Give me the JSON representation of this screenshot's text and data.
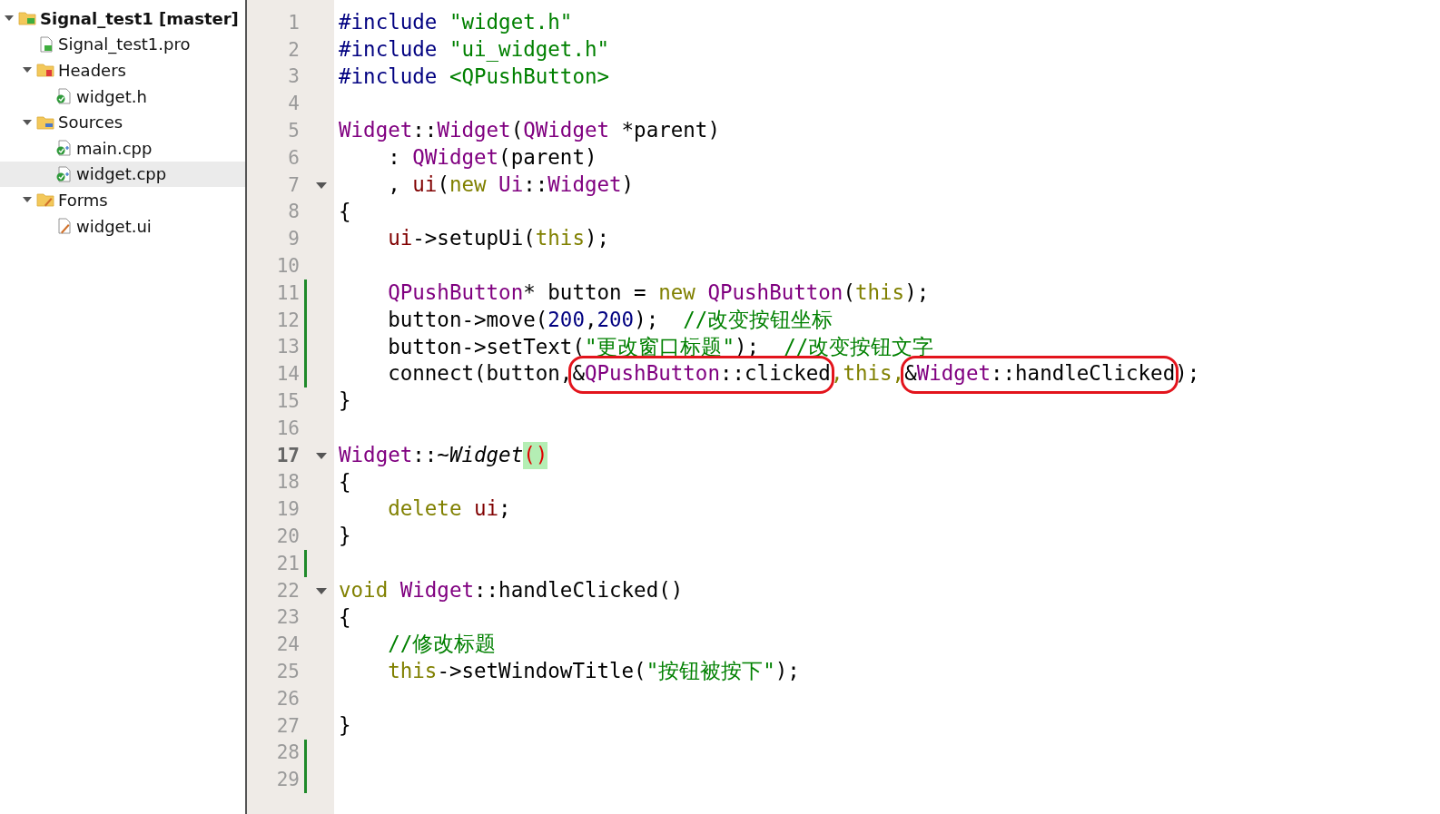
{
  "project_tree": [
    {
      "label": "Signal_test1 [master]",
      "kind": "project",
      "expanded": true,
      "selected": false,
      "children": [
        {
          "label": "Signal_test1.pro",
          "kind": "profile",
          "selected": false
        },
        {
          "label": "Headers",
          "kind": "headers",
          "expanded": true,
          "selected": false,
          "children": [
            {
              "label": "widget.h",
              "kind": "header",
              "selected": false
            }
          ]
        },
        {
          "label": "Sources",
          "kind": "sources",
          "expanded": true,
          "selected": false,
          "children": [
            {
              "label": "main.cpp",
              "kind": "source",
              "selected": false
            },
            {
              "label": "widget.cpp",
              "kind": "source",
              "selected": true
            }
          ]
        },
        {
          "label": "Forms",
          "kind": "forms",
          "expanded": true,
          "selected": false,
          "children": [
            {
              "label": "widget.ui",
              "kind": "form",
              "selected": false
            }
          ]
        }
      ]
    }
  ],
  "editor": {
    "lines": [
      {
        "number": "1",
        "changed": false,
        "fold": false,
        "current": false,
        "tokens": [
          {
            "t": "#include ",
            "kind": "preproc"
          },
          {
            "t": "\"widget.h\"",
            "kind": "string"
          }
        ]
      },
      {
        "number": "2",
        "changed": false,
        "fold": false,
        "current": false,
        "tokens": [
          {
            "t": "#include ",
            "kind": "preproc"
          },
          {
            "t": "\"ui_widget.h\"",
            "kind": "string"
          }
        ]
      },
      {
        "number": "3",
        "changed": false,
        "fold": false,
        "current": false,
        "tokens": [
          {
            "t": "#include ",
            "kind": "preproc"
          },
          {
            "t": "<QPushButton>",
            "kind": "string"
          }
        ]
      },
      {
        "number": "4",
        "changed": false,
        "fold": false,
        "current": false
      },
      {
        "number": "5",
        "changed": false,
        "fold": false,
        "current": false,
        "tokens": [
          {
            "t": "Widget",
            "kind": "type"
          },
          {
            "t": "::",
            "kind": "plain"
          },
          {
            "t": "Widget",
            "kind": "type"
          },
          {
            "t": "(",
            "kind": "plain"
          },
          {
            "t": "QWidget",
            "kind": "type"
          },
          {
            "t": " *parent)",
            "kind": "plain"
          }
        ]
      },
      {
        "number": "6",
        "changed": false,
        "fold": false,
        "current": false,
        "tokens": [
          {
            "t": "    : ",
            "kind": "plain"
          },
          {
            "t": "QWidget",
            "kind": "type"
          },
          {
            "t": "(parent)",
            "kind": "plain"
          }
        ]
      },
      {
        "number": "7",
        "changed": false,
        "fold": true,
        "current": false,
        "tokens": [
          {
            "t": "    , ",
            "kind": "plain"
          },
          {
            "t": "ui",
            "kind": "field"
          },
          {
            "t": "(",
            "kind": "plain"
          },
          {
            "t": "new ",
            "kind": "keyword"
          },
          {
            "t": "Ui",
            "kind": "type"
          },
          {
            "t": "::",
            "kind": "plain"
          },
          {
            "t": "Widget",
            "kind": "type"
          },
          {
            "t": ")",
            "kind": "plain"
          }
        ]
      },
      {
        "number": "8",
        "changed": false,
        "fold": false,
        "current": false,
        "tokens": [
          {
            "t": "{",
            "kind": "plain"
          }
        ]
      },
      {
        "number": "9",
        "changed": false,
        "fold": false,
        "current": false,
        "tokens": [
          {
            "t": "    ui",
            "kind": "field"
          },
          {
            "t": "->setupUi(",
            "kind": "plain"
          },
          {
            "t": "this",
            "kind": "keyword"
          },
          {
            "t": ");",
            "kind": "plain"
          }
        ]
      },
      {
        "number": "10",
        "changed": false,
        "fold": false,
        "current": false
      },
      {
        "number": "11",
        "changed": true,
        "fold": false,
        "current": false,
        "tokens": [
          {
            "t": "    QPushButton",
            "kind": "type"
          },
          {
            "t": "* button = ",
            "kind": "plain"
          },
          {
            "t": "new ",
            "kind": "keyword"
          },
          {
            "t": "QPushButton",
            "kind": "type"
          },
          {
            "t": "(",
            "kind": "plain"
          },
          {
            "t": "this",
            "kind": "keyword"
          },
          {
            "t": ");",
            "kind": "plain"
          }
        ]
      },
      {
        "number": "12",
        "changed": true,
        "fold": false,
        "current": false,
        "tokens": [
          {
            "t": "    button->move(",
            "kind": "plain"
          },
          {
            "t": "200",
            "kind": "number"
          },
          {
            "t": ",",
            "kind": "plain"
          },
          {
            "t": "200",
            "kind": "number"
          },
          {
            "t": ");  ",
            "kind": "plain"
          },
          {
            "t": "//改变按钮坐标",
            "kind": "comment"
          }
        ]
      },
      {
        "number": "13",
        "changed": true,
        "fold": false,
        "current": false,
        "tokens": [
          {
            "t": "    button->setText(",
            "kind": "plain"
          },
          {
            "t": "\"更改窗口标题\"",
            "kind": "string"
          },
          {
            "t": ");  ",
            "kind": "plain"
          },
          {
            "t": "//改变按钮文字",
            "kind": "comment"
          }
        ]
      },
      {
        "number": "14",
        "changed": true,
        "fold": false,
        "current": false,
        "tokens": [
          {
            "t": "    connect(button,",
            "kind": "plain"
          },
          {
            "kind": "circled",
            "tokens": [
              {
                "t": "&",
                "kind": "plain"
              },
              {
                "t": "QPushButton",
                "kind": "type"
              },
              {
                "t": "::clicked",
                "kind": "plain"
              }
            ]
          },
          {
            "t": ",this,",
            "kind": "keyword"
          },
          {
            "kind": "circled",
            "tokens": [
              {
                "t": "&",
                "kind": "plain"
              },
              {
                "t": "Widget",
                "kind": "type"
              },
              {
                "t": "::handleClicked",
                "kind": "plain"
              }
            ]
          },
          {
            "t": ");",
            "kind": "plain"
          }
        ]
      },
      {
        "number": "15",
        "changed": false,
        "fold": false,
        "current": false,
        "tokens": [
          {
            "t": "}",
            "kind": "plain"
          }
        ]
      },
      {
        "number": "16",
        "changed": false,
        "fold": false,
        "current": false
      },
      {
        "number": "17",
        "changed": false,
        "fold": true,
        "current": true,
        "tokens": [
          {
            "t": "Widget",
            "kind": "type"
          },
          {
            "t": "::~",
            "kind": "plain"
          },
          {
            "t": "Widget",
            "kind": "declname"
          },
          {
            "t": "()",
            "kind": "match"
          }
        ]
      },
      {
        "number": "18",
        "changed": false,
        "fold": false,
        "current": false,
        "tokens": [
          {
            "t": "{",
            "kind": "plain"
          }
        ]
      },
      {
        "number": "19",
        "changed": false,
        "fold": false,
        "current": false,
        "tokens": [
          {
            "t": "    delete ",
            "kind": "keyword"
          },
          {
            "t": "ui",
            "kind": "field"
          },
          {
            "t": ";",
            "kind": "plain"
          }
        ]
      },
      {
        "number": "20",
        "changed": false,
        "fold": false,
        "current": false,
        "tokens": [
          {
            "t": "}",
            "kind": "plain"
          }
        ]
      },
      {
        "number": "21",
        "changed": true,
        "fold": false,
        "current": false
      },
      {
        "number": "22",
        "changed": false,
        "fold": true,
        "current": false,
        "tokens": [
          {
            "t": "void ",
            "kind": "keyword"
          },
          {
            "t": "Widget",
            "kind": "type"
          },
          {
            "t": "::handleClicked()",
            "kind": "plain"
          }
        ]
      },
      {
        "number": "23",
        "changed": false,
        "fold": false,
        "current": false,
        "tokens": [
          {
            "t": "{",
            "kind": "plain"
          }
        ]
      },
      {
        "number": "24",
        "changed": false,
        "fold": false,
        "current": false,
        "tokens": [
          {
            "t": "    //修改标题",
            "kind": "comment"
          }
        ]
      },
      {
        "number": "25",
        "changed": false,
        "fold": false,
        "current": false,
        "tokens": [
          {
            "t": "    this",
            "kind": "keyword"
          },
          {
            "t": "->setWindowTitle(",
            "kind": "plain"
          },
          {
            "t": "\"按钮被按下\"",
            "kind": "string"
          },
          {
            "t": ");",
            "kind": "plain"
          }
        ]
      },
      {
        "number": "26",
        "changed": false,
        "fold": false,
        "current": false
      },
      {
        "number": "27",
        "changed": false,
        "fold": false,
        "current": false,
        "tokens": [
          {
            "t": "}",
            "kind": "plain"
          }
        ]
      },
      {
        "number": "28",
        "changed": true,
        "fold": false,
        "current": false
      },
      {
        "number": "29",
        "changed": true,
        "fold": false,
        "current": false
      }
    ]
  }
}
